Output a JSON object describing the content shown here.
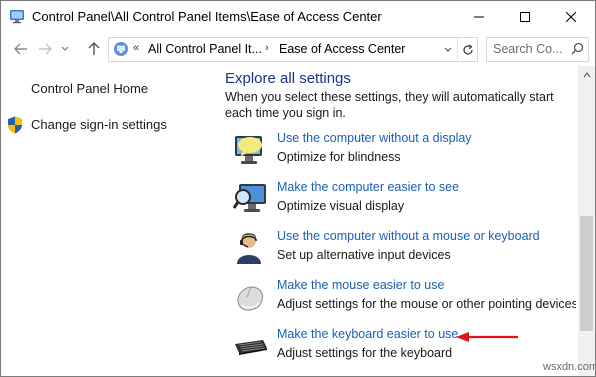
{
  "window": {
    "title": "Control Panel\\All Control Panel Items\\Ease of Access Center",
    "controls": [
      "minimize-icon",
      "maximize-icon",
      "close-icon"
    ]
  },
  "address": {
    "overflow": "«",
    "crumbs": [
      "All Control Panel It...",
      "Ease of Access Center"
    ],
    "separator": "›"
  },
  "search": {
    "placeholder": "Search Co..."
  },
  "sidebar": {
    "home": "Control Panel Home",
    "signin": "Change sign-in settings"
  },
  "main": {
    "heading": "Explore all settings",
    "description": "When you select these settings, they will automatically start each time you sign in.",
    "items": [
      {
        "link": "Use the computer without a display",
        "desc": "Optimize for blindness",
        "icon": "speech-monitor-icon"
      },
      {
        "link": "Make the computer easier to see",
        "desc": "Optimize visual display",
        "icon": "magnifier-monitor-icon"
      },
      {
        "link": "Use the computer without a mouse or keyboard",
        "desc": "Set up alternative input devices",
        "icon": "person-headset-icon"
      },
      {
        "link": "Make the mouse easier to use",
        "desc": "Adjust settings for the mouse or other pointing devices",
        "icon": "mouse-icon"
      },
      {
        "link": "Make the keyboard easier to use",
        "desc": "Adjust settings for the keyboard",
        "icon": "keyboard-icon"
      }
    ]
  },
  "watermark": "wsxdn.com",
  "colors": {
    "link": "#1a5fb4",
    "heading": "#1e3287",
    "annotation_arrow": "#e0141e"
  }
}
